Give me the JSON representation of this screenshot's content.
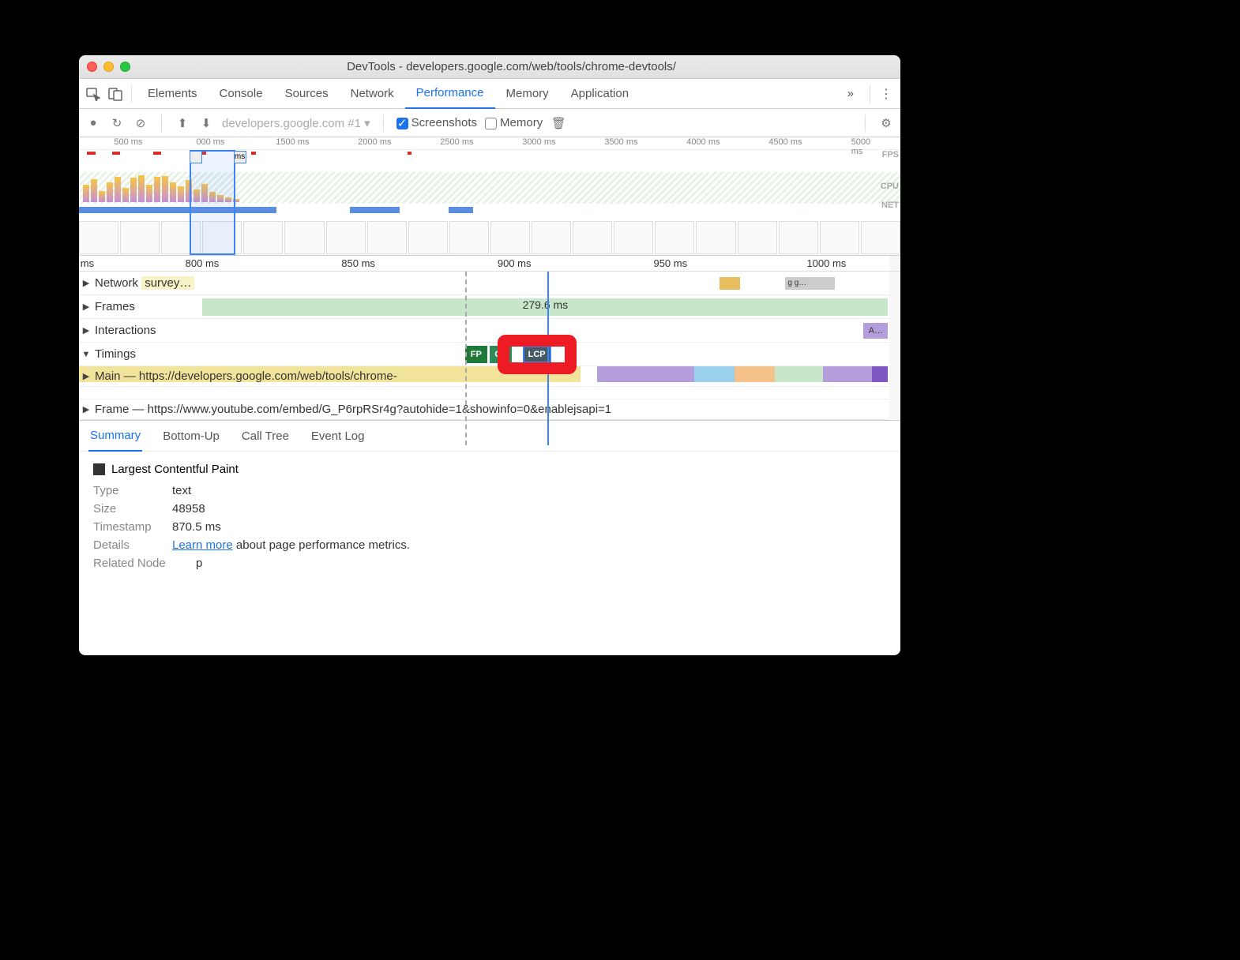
{
  "window": {
    "title": "DevTools - developers.google.com/web/tools/chrome-devtools/"
  },
  "tabs": {
    "items": [
      "Elements",
      "Console",
      "Sources",
      "Network",
      "Performance",
      "Memory",
      "Application"
    ],
    "active": "Performance"
  },
  "toolbar": {
    "dropdown": "developers.google.com #1",
    "screenshots": "Screenshots",
    "memory": "Memory"
  },
  "overview": {
    "ticks": [
      "500 ms",
      "000 ms",
      "1500 ms",
      "2000 ms",
      "2500 ms",
      "3000 ms",
      "3500 ms",
      "4000 ms",
      "4500 ms",
      "5000 ms"
    ],
    "labels": {
      "fps": "FPS",
      "cpu": "CPU",
      "net": "NET"
    },
    "handle_label": "ms"
  },
  "detail": {
    "ticks": [
      "ms",
      "800 ms",
      "850 ms",
      "900 ms",
      "950 ms",
      "1000 ms"
    ]
  },
  "tracks": {
    "network": {
      "label": "Network",
      "event": "survey…",
      "gg": "g g…"
    },
    "frames": {
      "label": "Frames",
      "duration": "279.6 ms"
    },
    "interactions": {
      "label": "Interactions",
      "ann": "A…"
    },
    "timings": {
      "label": "Timings",
      "fp": "FP",
      "fcp": "CP",
      "lcp": "LCP"
    },
    "main": {
      "label": "Main — https://developers.google.com/web/tools/chrome-"
    },
    "frame": {
      "label": "Frame — https://www.youtube.com/embed/G_P6rpRSr4g?autohide=1&showinfo=0&enablejsapi=1"
    }
  },
  "bottom_tabs": [
    "Summary",
    "Bottom-Up",
    "Call Tree",
    "Event Log"
  ],
  "summary": {
    "title": "Largest Contentful Paint",
    "rows": {
      "type_k": "Type",
      "type_v": "text",
      "size_k": "Size",
      "size_v": "48958",
      "ts_k": "Timestamp",
      "ts_v": "870.5 ms",
      "det_k": "Details",
      "det_link": "Learn more",
      "det_rest": " about page performance metrics.",
      "rel_k": "Related Node",
      "rel_v": "p"
    }
  }
}
